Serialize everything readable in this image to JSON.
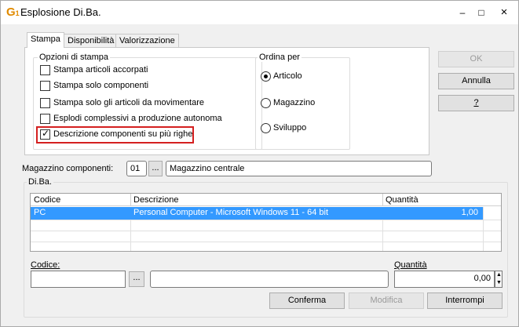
{
  "window": {
    "title": "Esplosione Di.Ba.",
    "minimize": "–",
    "maximize": "□",
    "close": "×"
  },
  "tabs": [
    "Stampa",
    "Disponibilità",
    "Valorizzazione"
  ],
  "print_options": {
    "legend": "Opzioni di stampa",
    "items": [
      {
        "label": "Stampa articoli accorpati",
        "checked": false
      },
      {
        "label": "Stampa solo componenti",
        "checked": false
      },
      {
        "label": "Stampa solo gli articoli da movimentare",
        "checked": false
      },
      {
        "label": "Esplodi complessivi a produzione autonoma",
        "checked": false
      },
      {
        "label": "Descrizione componenti su più righe",
        "checked": true
      }
    ]
  },
  "order_by": {
    "legend": "Ordina per",
    "options": [
      {
        "label": "Articolo",
        "selected": true
      },
      {
        "label": "Magazzino",
        "selected": false
      },
      {
        "label": "Sviluppo",
        "selected": false
      }
    ]
  },
  "side_buttons": {
    "ok": "OK",
    "annulla": "Annulla",
    "help": "?"
  },
  "warehouse": {
    "label": "Magazzino componenti:",
    "code": "01",
    "lookup": "...",
    "name": "Magazzino centrale"
  },
  "diba": {
    "legend": "Di.Ba.",
    "columns": [
      "Codice",
      "Descrizione",
      "Quantità"
    ],
    "rows": [
      {
        "codice": "PC",
        "descrizione": "Personal Computer - Microsoft Windows 11 - 64 bit",
        "quantita": "1,00"
      }
    ]
  },
  "editor": {
    "codice_label": "Codice:",
    "codice_value": "",
    "lookup": "...",
    "descrizione_value": "",
    "quantita_label": "Quantità",
    "quantita_value": "0,00"
  },
  "bottom_buttons": {
    "conferma": "Conferma",
    "modifica": "Modifica",
    "interrompi": "Interrompi"
  },
  "colors": {
    "selected_row": "#3399ff",
    "highlight_box": "#d42020",
    "title_icon": "#e08a00"
  }
}
